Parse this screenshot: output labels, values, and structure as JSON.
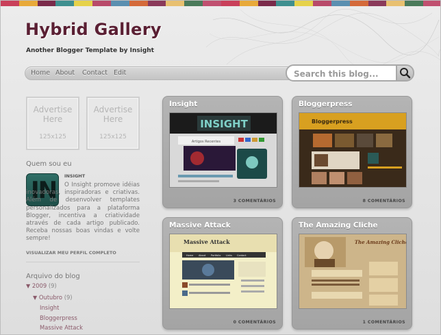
{
  "header": {
    "title": "Hybrid Gallery",
    "subtitle": "Another Blogger Template by Insight"
  },
  "nav": {
    "items": [
      "Home",
      "About",
      "Contact",
      "Edit"
    ]
  },
  "search": {
    "placeholder": "Search this blog..."
  },
  "sidebar": {
    "ads": [
      {
        "line1": "Advertise",
        "line2": "Here",
        "size": "125x125"
      },
      {
        "line1": "Advertise",
        "line2": "Here",
        "size": "125x125"
      }
    ],
    "about_heading": "Quem sou eu",
    "profile_name": "INSIGHT",
    "avatar_letters": "IN",
    "profile_text": "O Insight promove idéias inovadoras, inspiradoras e criativas. Além de desenvolver templates personalizados para a plataforma Blogger, incentiva a criatividade através de cada artigo publicado. Receba nossas boas vindas e volte sempre!",
    "profile_link": "VISUALIZAR MEU PERFIL COMPLETO",
    "archive_heading": "Arquivo do blog",
    "archive": {
      "year": "2009",
      "year_count": "(9)",
      "month": "Outubro",
      "month_count": "(9)",
      "posts": [
        "Insight",
        "Bloggerpress",
        "Massive Attack"
      ]
    }
  },
  "posts": [
    {
      "title": "Insight",
      "comments": "3 COMENTÁRIOS",
      "thumb": {
        "heading": "INSIGHT",
        "tagline": "Artigos Recentes"
      }
    },
    {
      "title": "Bloggerpress",
      "comments": "8 COMENTÁRIOS",
      "thumb": {
        "heading": "Bloggerpress"
      }
    },
    {
      "title": "Massive Attack",
      "comments": "0 COMENTÁRIOS",
      "thumb": {
        "heading": "Massive Attack",
        "tabs": [
          "Home",
          "About",
          "Portfolio",
          "Links",
          "Contact"
        ]
      }
    },
    {
      "title": "The Amazing Cliche",
      "comments": "1 COMENTÁRIOS",
      "thumb": {
        "heading": "The Amazing Cliche"
      }
    }
  ],
  "colors": {
    "stripe": [
      "#c9405a",
      "#e8a93a",
      "#7a2a4a",
      "#3f8f8f",
      "#e6d24a",
      "#b84a6a",
      "#5a8fb0",
      "#d46a3a",
      "#8a3a5a",
      "#e8c070",
      "#4a7a5a",
      "#c05070"
    ],
    "title": "#5a1f33",
    "link": "#8a5a6a"
  }
}
